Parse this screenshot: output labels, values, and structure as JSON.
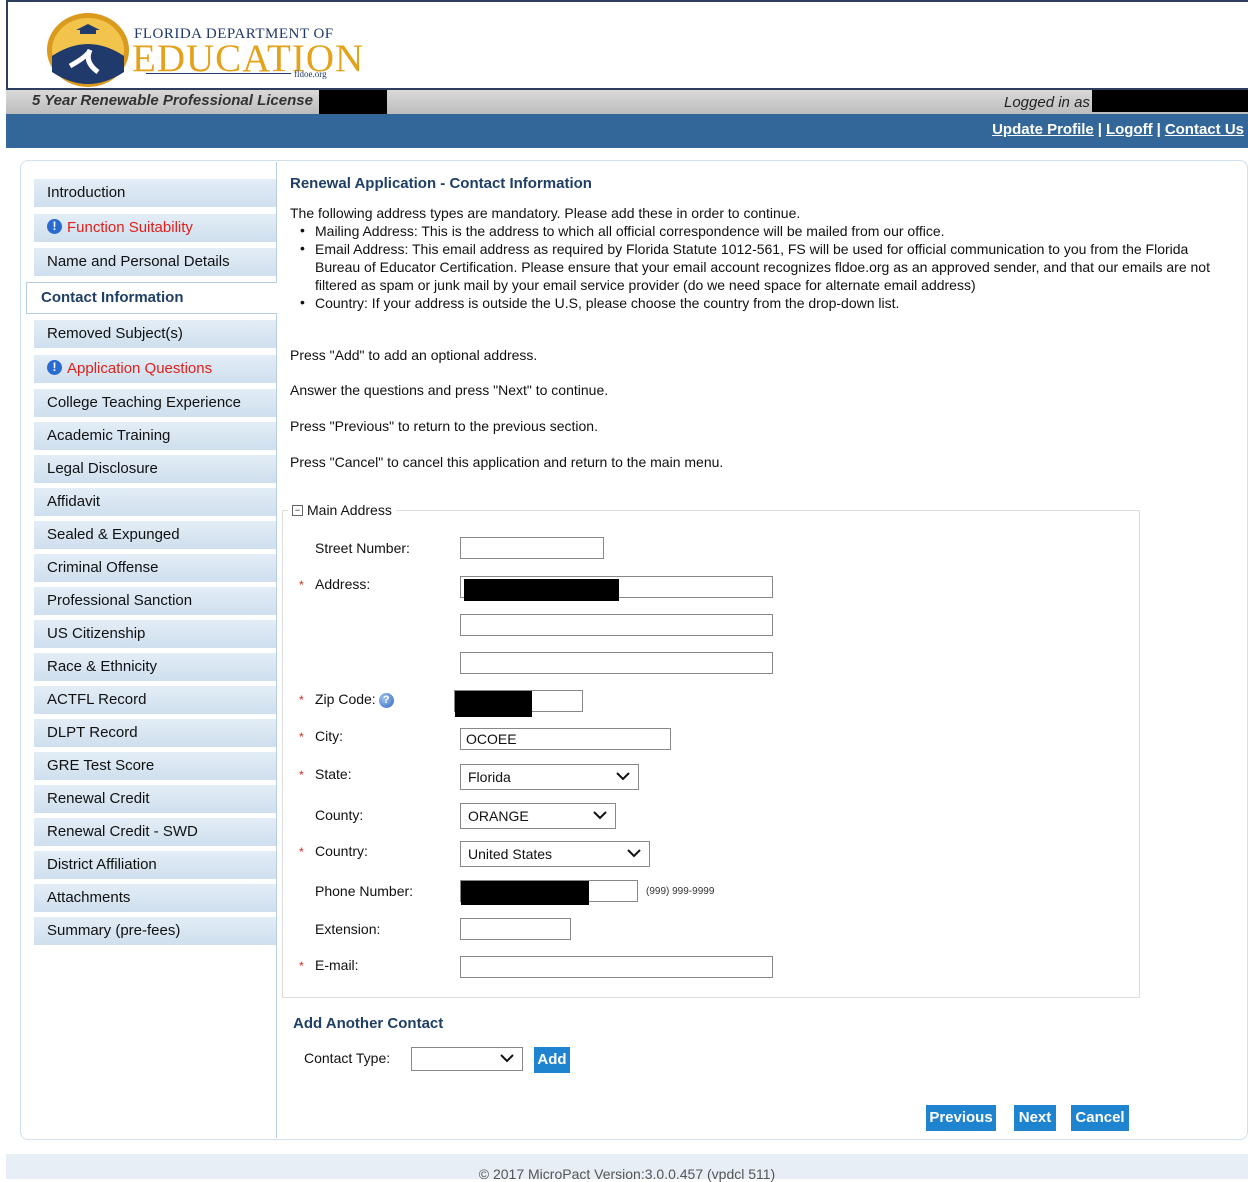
{
  "header": {
    "logo_top": "FLORIDA DEPARTMENT OF",
    "logo_main": "EDUCATION",
    "logo_sub": "fldoe.org",
    "license_title": "5 Year Renewable Professional License",
    "logged_in_label": "Logged in as"
  },
  "nav": {
    "update_profile": "Update Profile",
    "logoff": "Logoff",
    "contact_us": "Contact Us",
    "separator": "|"
  },
  "sidebar": {
    "items": [
      {
        "label": "Introduction",
        "state": "normal"
      },
      {
        "label": "Function Suitability",
        "state": "warning"
      },
      {
        "label": "Name and Personal Details",
        "state": "normal"
      },
      {
        "label": "Contact Information",
        "state": "active"
      },
      {
        "label": "Removed Subject(s)",
        "state": "normal"
      },
      {
        "label": "Application Questions",
        "state": "warning"
      },
      {
        "label": "College Teaching Experience",
        "state": "normal"
      },
      {
        "label": "Academic Training",
        "state": "normal"
      },
      {
        "label": "Legal Disclosure",
        "state": "normal"
      },
      {
        "label": "Affidavit",
        "state": "normal"
      },
      {
        "label": "Sealed & Expunged",
        "state": "normal"
      },
      {
        "label": "Criminal Offense",
        "state": "normal"
      },
      {
        "label": "Professional Sanction",
        "state": "normal"
      },
      {
        "label": "US Citizenship",
        "state": "normal"
      },
      {
        "label": "Race & Ethnicity",
        "state": "normal"
      },
      {
        "label": "ACTFL Record",
        "state": "normal"
      },
      {
        "label": "DLPT Record",
        "state": "normal"
      },
      {
        "label": "GRE Test Score",
        "state": "normal"
      },
      {
        "label": "Renewal Credit",
        "state": "normal"
      },
      {
        "label": "Renewal Credit - SWD",
        "state": "normal"
      },
      {
        "label": "District Affiliation",
        "state": "normal"
      },
      {
        "label": "Attachments",
        "state": "normal"
      },
      {
        "label": "Summary (pre-fees)",
        "state": "normal"
      }
    ],
    "warning_icon": "exclamation-circle-icon"
  },
  "main": {
    "title": "Renewal Application - Contact Information",
    "intro": "The following address types are mandatory. Please add these in order to continue.",
    "bullets": [
      "Mailing Address: This is the address to which all official correspondence will be mailed from our office.",
      "Email Address: This email address as required by Florida Statute 1012-561, FS will be used for official communication to you from the Florida Bureau of Educator Certification. Please ensure that your email account recognizes fldoe.org as an approved sender, and that our emails are not filtered as spam or junk mail by your email service provider (do we need space for alternate email address)",
      "Country: If your address is outside the U.S, please choose the country from the drop-down list."
    ],
    "instructions": [
      "Press \"Add\" to add an optional address.",
      "Answer the questions and press \"Next\" to continue.",
      "Press \"Previous\" to return to the previous section.",
      "Press \"Cancel\" to cancel this application and return to the main menu."
    ]
  },
  "address_form": {
    "legend": "Main Address",
    "street_number_label": "Street Number:",
    "street_number_value": "",
    "address_label": "Address:",
    "address_line2_value": "",
    "address_line3_value": "",
    "zip_label": "Zip Code:",
    "city_label": "City:",
    "city_value": "OCOEE",
    "state_label": "State:",
    "state_value": "Florida",
    "county_label": "County:",
    "county_value": "ORANGE",
    "country_label": "Country:",
    "country_value": "United States",
    "phone_label": "Phone Number:",
    "phone_hint": "(999) 999-9999",
    "extension_label": "Extension:",
    "extension_value": "",
    "email_label": "E-mail:",
    "email_value": "",
    "required_marker": "*"
  },
  "add_contact": {
    "title": "Add Another Contact",
    "contact_type_label": "Contact Type:",
    "contact_type_value": "",
    "add_button": "Add"
  },
  "actions": {
    "previous": "Previous",
    "next": "Next",
    "cancel": "Cancel"
  },
  "footer": {
    "text": "© 2017 MicroPact Version:3.0.0.457 (vpdcl 511)"
  },
  "colors": {
    "nav_bar": "#336699",
    "button": "#1e84cf",
    "warning_text": "#e0201a",
    "heading": "#1f3f66"
  }
}
